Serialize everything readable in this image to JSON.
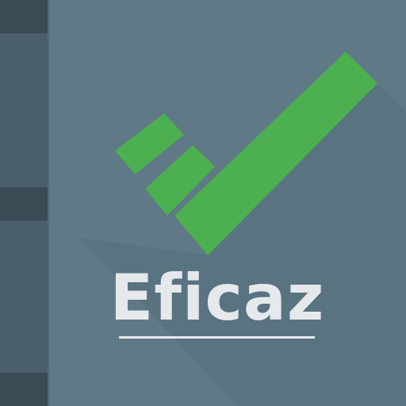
{
  "app_icon": {
    "name": "Eficaz",
    "colors": {
      "cover": "#5f7987",
      "spine": "#4a5f6b",
      "spine_band": "#3a4b55",
      "check_mark": "#4caf50",
      "wordmark": "#e6e9eb",
      "long_shadow": "#566f7c"
    },
    "icons": [
      "notebook-spine-icon",
      "check-mark-icon"
    ]
  }
}
